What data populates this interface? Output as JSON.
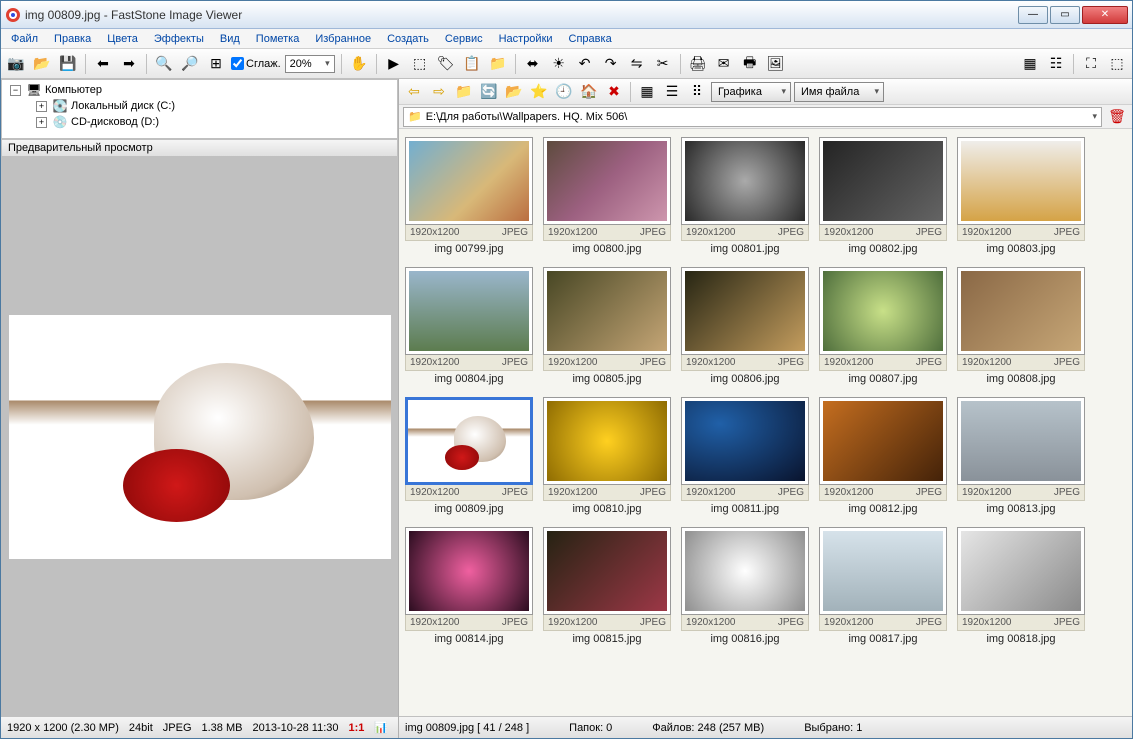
{
  "window": {
    "title": "img 00809.jpg  -  FastStone Image Viewer"
  },
  "menu": [
    "Файл",
    "Правка",
    "Цвета",
    "Эффекты",
    "Вид",
    "Пометка",
    "Избранное",
    "Создать",
    "Сервис",
    "Настройки",
    "Справка"
  ],
  "toolbar": {
    "smooth_label": "Сглаж.",
    "zoom_pct": "20%"
  },
  "tree": {
    "root": "Компьютер",
    "children": [
      {
        "label": "Локальный диск (C:)"
      },
      {
        "label": "CD-дисковод (D:)"
      }
    ]
  },
  "preview_header": "Предварительный просмотр",
  "left_status": {
    "dims": "1920 x 1200 (2.30 MP)",
    "depth": "24bit",
    "fmt": "JPEG",
    "size": "1.38 MB",
    "date": "2013-10-28 11:30",
    "ratio": "1:1"
  },
  "nav": {
    "view_combo": "Графика",
    "sort_combo": "Имя файла"
  },
  "path": "E:\\Для работы\\Wallpapers. HQ. Mix 506\\",
  "thumbs": [
    {
      "name": "img 00799.jpg",
      "dim": "1920x1200",
      "fmt": "JPEG",
      "cls": "tg0"
    },
    {
      "name": "img 00800.jpg",
      "dim": "1920x1200",
      "fmt": "JPEG",
      "cls": "tg1"
    },
    {
      "name": "img 00801.jpg",
      "dim": "1920x1200",
      "fmt": "JPEG",
      "cls": "tg2"
    },
    {
      "name": "img 00802.jpg",
      "dim": "1920x1200",
      "fmt": "JPEG",
      "cls": "tg3"
    },
    {
      "name": "img 00803.jpg",
      "dim": "1920x1200",
      "fmt": "JPEG",
      "cls": "tg4"
    },
    {
      "name": "img 00804.jpg",
      "dim": "1920x1200",
      "fmt": "JPEG",
      "cls": "tg5"
    },
    {
      "name": "img 00805.jpg",
      "dim": "1920x1200",
      "fmt": "JPEG",
      "cls": "tg6"
    },
    {
      "name": "img 00806.jpg",
      "dim": "1920x1200",
      "fmt": "JPEG",
      "cls": "tg7"
    },
    {
      "name": "img 00807.jpg",
      "dim": "1920x1200",
      "fmt": "JPEG",
      "cls": "tg8"
    },
    {
      "name": "img 00808.jpg",
      "dim": "1920x1200",
      "fmt": "JPEG",
      "cls": "tg9"
    },
    {
      "name": "img 00809.jpg",
      "dim": "1920x1200",
      "fmt": "JPEG",
      "cls": "tg10",
      "selected": true
    },
    {
      "name": "img 00810.jpg",
      "dim": "1920x1200",
      "fmt": "JPEG",
      "cls": "tg11"
    },
    {
      "name": "img 00811.jpg",
      "dim": "1920x1200",
      "fmt": "JPEG",
      "cls": "tg12"
    },
    {
      "name": "img 00812.jpg",
      "dim": "1920x1200",
      "fmt": "JPEG",
      "cls": "tg13"
    },
    {
      "name": "img 00813.jpg",
      "dim": "1920x1200",
      "fmt": "JPEG",
      "cls": "tg14"
    },
    {
      "name": "img 00814.jpg",
      "dim": "1920x1200",
      "fmt": "JPEG",
      "cls": "tg15"
    },
    {
      "name": "img 00815.jpg",
      "dim": "1920x1200",
      "fmt": "JPEG",
      "cls": "tg16"
    },
    {
      "name": "img 00816.jpg",
      "dim": "1920x1200",
      "fmt": "JPEG",
      "cls": "tg17"
    },
    {
      "name": "img 00817.jpg",
      "dim": "1920x1200",
      "fmt": "JPEG",
      "cls": "tg18"
    },
    {
      "name": "img 00818.jpg",
      "dim": "1920x1200",
      "fmt": "JPEG",
      "cls": "tg19"
    }
  ],
  "right_status": {
    "current": "img 00809.jpg  [ 41 / 248 ]",
    "folders": "Папок: 0",
    "files": "Файлов: 248 (257 MB)",
    "selected": "Выбрано: 1"
  }
}
